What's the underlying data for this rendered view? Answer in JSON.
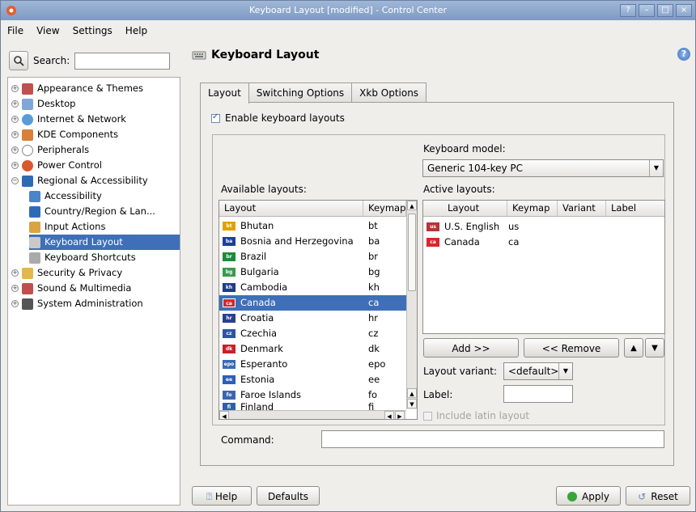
{
  "window": {
    "title": "Keyboard Layout [modified] - Control Center"
  },
  "menubar": [
    "File",
    "View",
    "Settings",
    "Help"
  ],
  "search": {
    "label": "Search:",
    "value": ""
  },
  "tree": [
    {
      "label": "Appearance & Themes",
      "level": 0,
      "expander": "+",
      "icon": "#c0504d"
    },
    {
      "label": "Desktop",
      "level": 0,
      "expander": "+",
      "icon": "#7fa7d8"
    },
    {
      "label": "Internet & Network",
      "level": 0,
      "expander": "+",
      "icon": "#5a9bd5"
    },
    {
      "label": "KDE Components",
      "level": 0,
      "expander": "+",
      "icon": "#d87f3a"
    },
    {
      "label": "Peripherals",
      "level": 0,
      "expander": "+",
      "icon": "#dcdcdc"
    },
    {
      "label": "Power Control",
      "level": 0,
      "expander": "+",
      "icon": "#d8582e"
    },
    {
      "label": "Regional & Accessibility",
      "level": 0,
      "expander": "−",
      "icon": "#2f6bb3"
    },
    {
      "label": "Accessibility",
      "level": 1,
      "icon": "#4c83c9"
    },
    {
      "label": "Country/Region & Lan...",
      "level": 1,
      "icon": "#2f6bb3"
    },
    {
      "label": "Input Actions",
      "level": 1,
      "icon": "#d9a441"
    },
    {
      "label": "Keyboard Layout",
      "level": 1,
      "icon": "#c9c9c9",
      "selected": true
    },
    {
      "label": "Keyboard Shortcuts",
      "level": 1,
      "icon": "#aaaaaa"
    },
    {
      "label": "Security & Privacy",
      "level": 0,
      "expander": "+",
      "icon": "#e1b94a"
    },
    {
      "label": "Sound & Multimedia",
      "level": 0,
      "expander": "+",
      "icon": "#c0504d"
    },
    {
      "label": "System Administration",
      "level": 0,
      "expander": "+",
      "icon": "#555555"
    }
  ],
  "header": {
    "title": "Keyboard Layout"
  },
  "tabs": [
    "Layout",
    "Switching Options",
    "Xkb Options"
  ],
  "enable_layouts": {
    "label": "Enable keyboard layouts",
    "checked": true
  },
  "keyboard_model": {
    "label": "Keyboard model:",
    "value": "Generic 104-key PC"
  },
  "available": {
    "label": "Available layouts:",
    "columns": [
      "Layout",
      "Keymap"
    ],
    "rows": [
      {
        "flag": "bt",
        "color": "#e0a000",
        "name": "Bhutan",
        "keymap": "bt"
      },
      {
        "flag": "ba",
        "color": "#1d3f9e",
        "name": "Bosnia and Herzegovina",
        "keymap": "ba"
      },
      {
        "flag": "br",
        "color": "#1e8a3a",
        "name": "Brazil",
        "keymap": "br"
      },
      {
        "flag": "bg",
        "color": "#3a9a4a",
        "name": "Bulgaria",
        "keymap": "bg"
      },
      {
        "flag": "kh",
        "color": "#1e3c8c",
        "name": "Cambodia",
        "keymap": "kh"
      },
      {
        "flag": "ca",
        "color": "#d8262d",
        "name": "Canada",
        "keymap": "ca",
        "selected": true
      },
      {
        "flag": "hr",
        "color": "#2a3f8f",
        "name": "Croatia",
        "keymap": "hr"
      },
      {
        "flag": "cz",
        "color": "#2d55a6",
        "name": "Czechia",
        "keymap": "cz"
      },
      {
        "flag": "dk",
        "color": "#c8202a",
        "name": "Denmark",
        "keymap": "dk"
      },
      {
        "flag": "epo",
        "color": "#3a6ab5",
        "name": "Esperanto",
        "keymap": "epo"
      },
      {
        "flag": "ee",
        "color": "#2c60b8",
        "name": "Estonia",
        "keymap": "ee"
      },
      {
        "flag": "fo",
        "color": "#3a66b0",
        "name": "Faroe Islands",
        "keymap": "fo"
      },
      {
        "flag": "fi",
        "color": "#2d5fb0",
        "name": "Finland",
        "keymap": "fi"
      }
    ]
  },
  "active": {
    "label": "Active layouts:",
    "columns": [
      "Layout",
      "Keymap",
      "Variant",
      "Label"
    ],
    "rows": [
      {
        "flag": "us",
        "color": "#b8323a",
        "name": "U.S. English",
        "keymap": "us"
      },
      {
        "flag": "ca",
        "color": "#d8262d",
        "name": "Canada",
        "keymap": "ca"
      }
    ]
  },
  "buttons": {
    "add": "Add >>",
    "remove": "<< Remove",
    "up": "▲",
    "down": "▼",
    "help": "Help",
    "defaults": "Defaults",
    "apply": "Apply",
    "reset": "Reset"
  },
  "layout_variant": {
    "label": "Layout variant:",
    "value": "<default>"
  },
  "label_field": {
    "label": "Label:",
    "value": ""
  },
  "include_latin": {
    "label": "Include latin layout",
    "checked": false
  },
  "command": {
    "label": "Command:",
    "value": ""
  }
}
